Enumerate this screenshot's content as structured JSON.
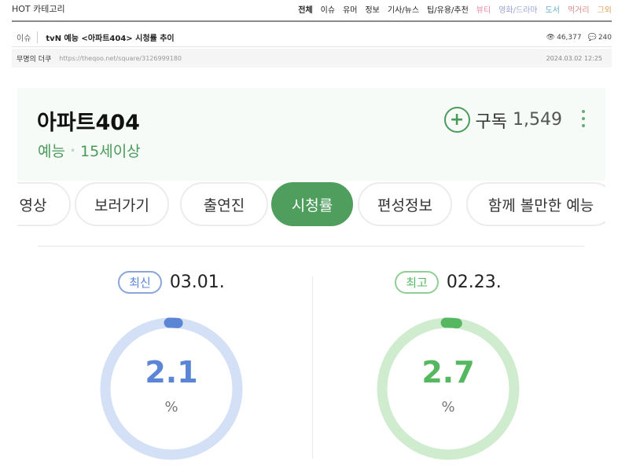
{
  "topnav": {
    "brand": "HOT 카테고리",
    "items": [
      {
        "label": "전체",
        "color": "#222222",
        "bold": true
      },
      {
        "label": "이슈",
        "color": "#222222"
      },
      {
        "label": "유머",
        "color": "#222222"
      },
      {
        "label": "정보",
        "color": "#222222"
      },
      {
        "label": "기사/뉴스",
        "color": "#222222"
      },
      {
        "label": "팁/유용/추천",
        "color": "#222222"
      },
      {
        "label": "뷰티",
        "color": "#e88aa8"
      },
      {
        "label": "영화/드라마",
        "color": "#9aa4cf"
      },
      {
        "label": "도서",
        "color": "#6bb1c9"
      },
      {
        "label": "먹거리",
        "color": "#d98a8a"
      },
      {
        "label": "그외",
        "color": "#e0a060"
      }
    ]
  },
  "post": {
    "category": "이슈",
    "title": "tvN 예능 <아파트404> 시청률 추이",
    "views": "46,377",
    "comments": "240",
    "author": "무명의 더쿠",
    "url": "https://theqoo.net/square/3126999180",
    "datetime": "2024.03.02 12:25"
  },
  "show": {
    "title": "아파트404",
    "genre": "예능",
    "rating_age": "15세이상",
    "subscribe_label": "구독",
    "subscribe_count": "1,549"
  },
  "tabs": [
    "영상",
    "보러가기",
    "출연진",
    "시청률",
    "편성정보",
    "함께 볼만한 예능"
  ],
  "active_tab": "시청률",
  "ratings": {
    "latest": {
      "badge": "최신",
      "date": "03.01.",
      "value": "2.1",
      "unit": "%",
      "color": "#5b86d6",
      "track": "#d3e0f6",
      "border": "#8aa6d8",
      "fraction": 0.021
    },
    "best": {
      "badge": "최고",
      "date": "02.23.",
      "value": "2.7",
      "unit": "%",
      "color": "#55b861",
      "track": "#cfeccf",
      "border": "#8fcf95",
      "fraction": 0.027
    }
  }
}
